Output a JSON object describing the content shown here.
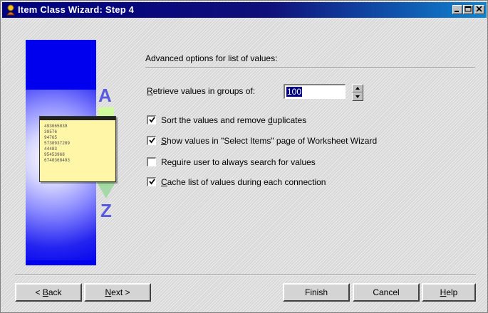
{
  "window": {
    "title": "Item Class Wizard: Step 4",
    "title_bar_buttons": [
      "minimize-icon",
      "maximize-icon",
      "close-icon"
    ],
    "colors": {
      "title_bar": "#000080",
      "art_panel": "#0000ee",
      "card": "#fff6a8",
      "selection": "#000080"
    }
  },
  "illustration": {
    "letter_top": "A",
    "letter_bottom": "Z",
    "card_numbers": [
      "493065839",
      "39576",
      "94765",
      "5738937289",
      "44483",
      "95453968",
      "6748368493"
    ]
  },
  "options": {
    "section_title": "Advanced options for list of values:",
    "retrieve": {
      "label_mnemonic": "R",
      "label_rest": "etrieve values in groups of:",
      "value": "100"
    },
    "checkboxes": [
      {
        "pre": "Sort the values and remove ",
        "mnemonic": "d",
        "post": "uplicates",
        "checked": true
      },
      {
        "pre": "",
        "mnemonic": "S",
        "post": "how values in \"Select Items\" page of Worksheet Wizard",
        "checked": true
      },
      {
        "pre": "Re",
        "mnemonic": "q",
        "post": "uire user to always search for values",
        "checked": false
      },
      {
        "pre": "",
        "mnemonic": "C",
        "post": "ache list of values during each connection",
        "checked": true
      }
    ]
  },
  "buttons": {
    "back": {
      "pre": "< ",
      "mnemonic": "B",
      "post": "ack"
    },
    "next": {
      "pre": "",
      "mnemonic": "N",
      "post": "ext >"
    },
    "finish": "Finish",
    "cancel": "Cancel",
    "help": {
      "mnemonic": "H",
      "post": "elp"
    }
  }
}
